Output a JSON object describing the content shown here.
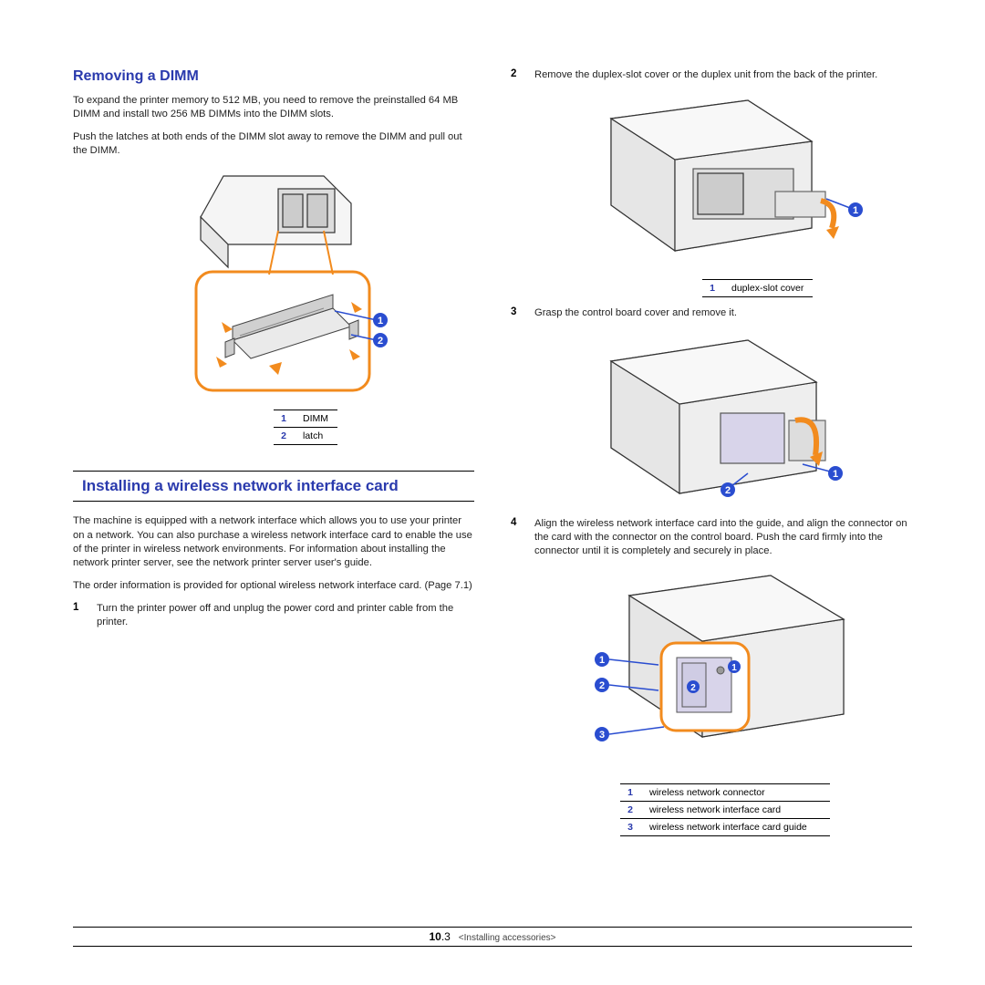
{
  "left": {
    "h_dimm": "Removing a DIMM",
    "p1": "To expand the printer memory to 512 MB, you need to remove the preinstalled 64 MB DIMM and install two 256 MB DIMMs into the DIMM slots.",
    "p2": "Push the latches at both ends of the DIMM slot away to remove the DIMM and pull out the DIMM.",
    "legend1": {
      "r1n": "1",
      "r1t": "DIMM",
      "r2n": "2",
      "r2t": "latch"
    },
    "h_wifi": "Installing a wireless network interface card",
    "p3": "The machine is equipped with a network interface which allows you to use your printer on a network. You can also purchase a wireless network interface card to enable the use of the printer in wireless network environments. For information about installing the network printer server, see the network printer server user's guide.",
    "p4": "The order information is provided for optional wireless network interface card. (Page 7.1)",
    "s1n": "1",
    "s1t": "Turn the printer power off and unplug the power cord and printer cable from the printer."
  },
  "right": {
    "s2n": "2",
    "s2t": "Remove the duplex-slot cover or the duplex unit from the back of the printer.",
    "legend2": {
      "r1n": "1",
      "r1t": "duplex-slot cover"
    },
    "s3n": "3",
    "s3t": "Grasp the control board cover and remove it.",
    "s4n": "4",
    "s4t": "Align the wireless network interface card into the guide, and align the connector on the card with the connector on the control board. Push the card firmly into the connector until it is completely and securely in place.",
    "legend3": {
      "r1n": "1",
      "r1t": "wireless network connector",
      "r2n": "2",
      "r2t": "wireless network interface card",
      "r3n": "3",
      "r3t": "wireless network interface card guide"
    }
  },
  "footer": {
    "chap": "10",
    "page": ".3",
    "name": "<Installing accessories>"
  },
  "callouts": {
    "c1": "1",
    "c2": "2",
    "c3": "3"
  }
}
